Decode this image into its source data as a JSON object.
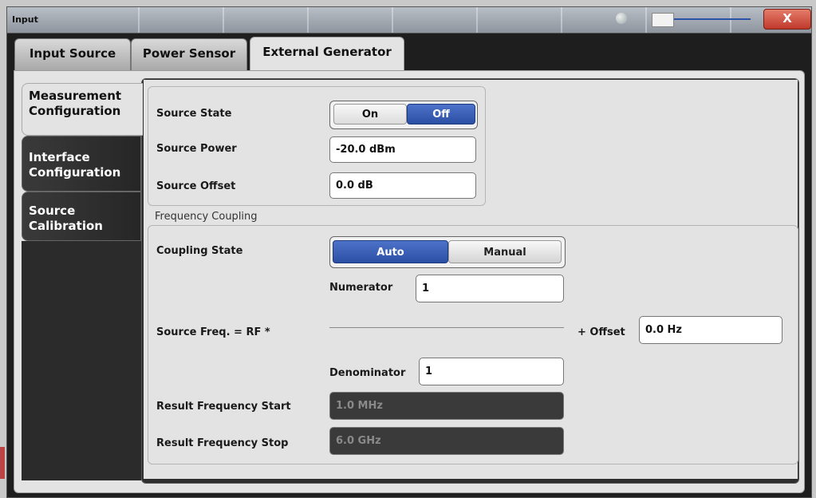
{
  "window": {
    "title": "Input",
    "close_label": "X"
  },
  "tabs": [
    {
      "label": "Input Source"
    },
    {
      "label": "Power Sensor"
    },
    {
      "label": "External Generator",
      "selected": true
    }
  ],
  "side_tabs": [
    {
      "label": "Measurement Configuration",
      "selected": true
    },
    {
      "label": "Interface Configuration"
    },
    {
      "label": "Source Calibration"
    }
  ],
  "source": {
    "state_label": "Source State",
    "state_on": "On",
    "state_off": "Off",
    "state_value": "Off",
    "power_label": "Source Power",
    "power_value": "-20.0 dBm",
    "offset_label": "Source Offset",
    "offset_value": "0.0 dB"
  },
  "frequency_coupling": {
    "title": "Frequency Coupling",
    "coupling_label": "Coupling State",
    "auto_label": "Auto",
    "manual_label": "Manual",
    "coupling_value": "Auto",
    "numerator_label": "Numerator",
    "numerator_value": "1",
    "formula_label": "Source Freq. = RF *",
    "offset_label": "+ Offset",
    "offset_value": "0.0 Hz",
    "denominator_label": "Denominator",
    "denominator_value": "1",
    "result_start_label": "Result Frequency Start",
    "result_start_value": "1.0 MHz",
    "result_stop_label": "Result Frequency Stop",
    "result_stop_value": "6.0 GHz"
  },
  "colors": {
    "accent_blue": "#2a4fa3",
    "close_red": "#c0392b",
    "panel_bg": "#e3e3e3",
    "dark_bg": "#1e1e1e"
  }
}
